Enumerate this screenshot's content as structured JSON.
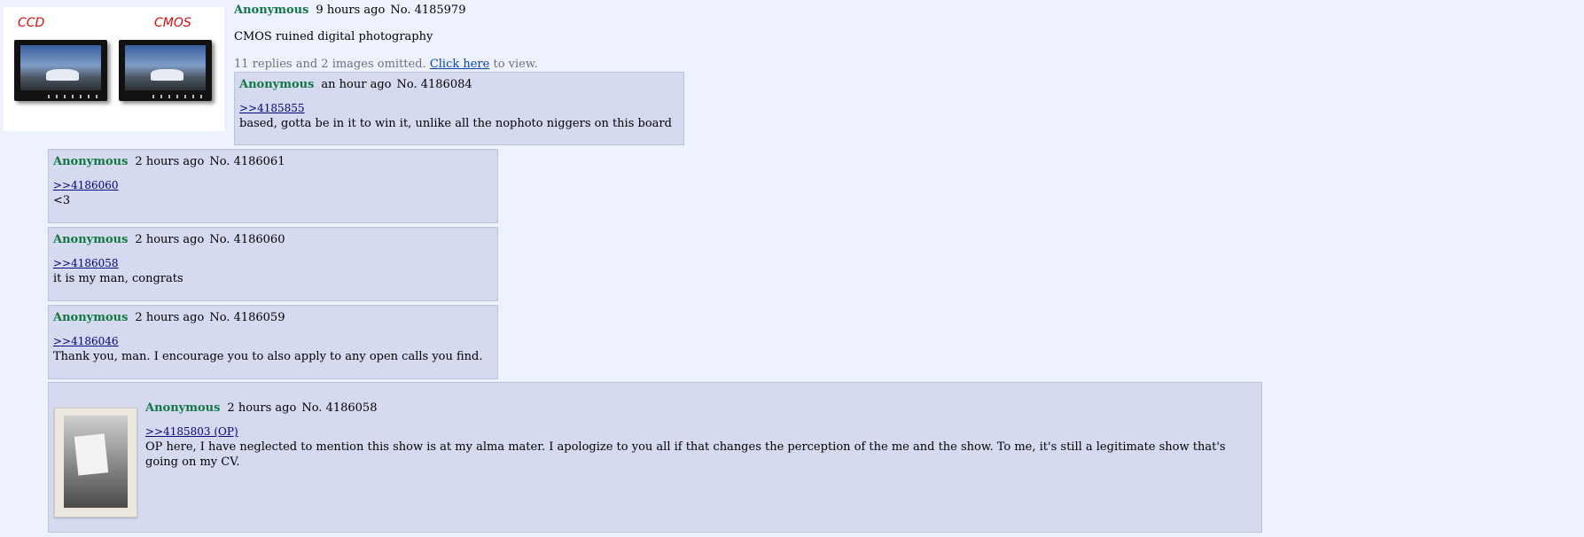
{
  "op": {
    "name": "Anonymous",
    "time": "9 hours ago",
    "post_no": "No. 4185979",
    "text": "CMOS ruined digital photography",
    "thumb_labels": {
      "left": "CCD",
      "right": "CMOS"
    },
    "omitted": {
      "prefix": "11 replies and 2 images omitted.",
      "link": "Click here",
      "suffix": "to view."
    }
  },
  "replies": [
    {
      "name": "Anonymous",
      "time": "an hour ago",
      "post_no": "No. 4186084",
      "quote": ">>4185855",
      "text": "based, gotta be in it to win it, unlike all the nophoto niggers on this board"
    },
    {
      "name": "Anonymous",
      "time": "2 hours ago",
      "post_no": "No. 4186061",
      "quote": ">>4186060",
      "text": "<3"
    },
    {
      "name": "Anonymous",
      "time": "2 hours ago",
      "post_no": "No. 4186060",
      "quote": ">>4186058",
      "text": "it is my man, congrats"
    },
    {
      "name": "Anonymous",
      "time": "2 hours ago",
      "post_no": "No. 4186059",
      "quote": ">>4186046",
      "text": "Thank you, man. I encourage you to also apply to any open calls you find."
    },
    {
      "name": "Anonymous",
      "time": "2 hours ago",
      "post_no": "No. 4186058",
      "quote": ">>4185803 (OP)",
      "text": "OP here, I have neglected to mention this show is at my alma mater. I apologize to you all if that changes the perception of the me and the show. To me, it's still a legitimate show that's going on my CV."
    }
  ],
  "colors": {
    "background": "#eef2ff",
    "reply_bg": "#d6daf0",
    "name": "#117743",
    "quote_link": "#000080"
  }
}
